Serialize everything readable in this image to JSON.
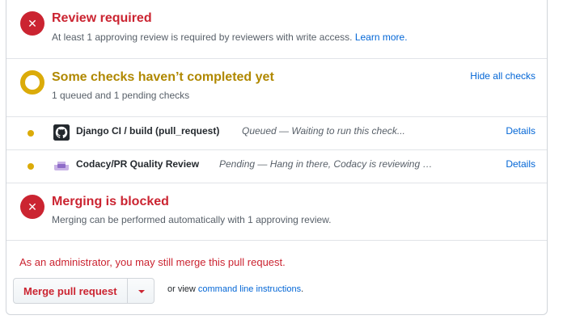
{
  "review": {
    "title": "Review required",
    "desc": "At least 1 approving review is required by reviewers with write access.",
    "learn_more": "Learn more."
  },
  "checks": {
    "title": "Some checks haven’t completed yet",
    "summary": "1 queued and 1 pending checks",
    "hide_all": "Hide all checks",
    "items": [
      {
        "name": "Django CI / build (pull_request)",
        "status": "Queued — Waiting to run this check...",
        "details": "Details",
        "icon": "github-icon"
      },
      {
        "name": "Codacy/PR Quality Review",
        "status": "Pending — Hang in there, Codacy is reviewing …",
        "details": "Details",
        "icon": "codacy-icon"
      }
    ]
  },
  "merging": {
    "title": "Merging is blocked",
    "desc": "Merging can be performed automatically with 1 approving review."
  },
  "admin": {
    "note": "As an administrator, you may still merge this pull request.",
    "merge_button": "Merge pull request",
    "or_view": "or view",
    "cli_link": "command line instructions",
    "period": "."
  },
  "colors": {
    "error": "#cb2431",
    "pending": "#dbab09",
    "link": "#0366d6"
  }
}
